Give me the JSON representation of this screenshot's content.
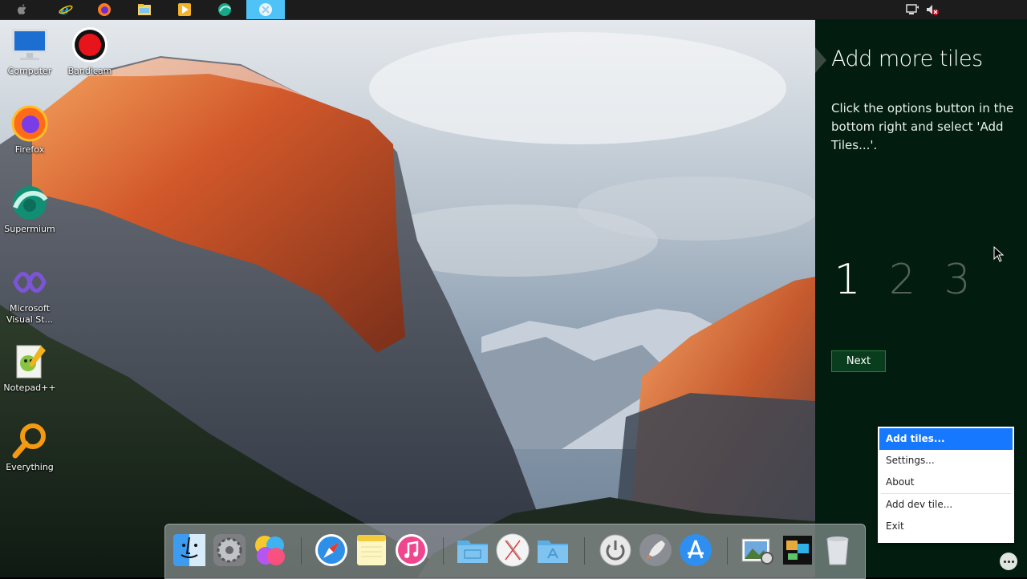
{
  "taskbar": {
    "buttons": [
      {
        "name": "apple-menu-icon"
      },
      {
        "name": "internet-explorer-icon"
      },
      {
        "name": "firefox-icon"
      },
      {
        "name": "file-explorer-icon"
      },
      {
        "name": "media-player-icon"
      },
      {
        "name": "supermium-icon"
      },
      {
        "name": "xwidget-icon",
        "active": true
      }
    ],
    "tray": [
      "network-icon",
      "volume-muted-icon"
    ]
  },
  "desktop": {
    "icons": [
      {
        "label": "Computer"
      },
      {
        "label": "Bandicam"
      },
      {
        "label": "Firefox"
      },
      {
        "label": "Supermium"
      },
      {
        "label": "Microsoft Visual St..."
      },
      {
        "label": "Notepad++"
      },
      {
        "label": "Everything"
      }
    ]
  },
  "panel": {
    "title": "Add more tiles",
    "body": "Click the options button in the bottom right and select 'Add Tiles...'.",
    "steps": [
      "1",
      "2",
      "3"
    ],
    "next_label": "Next"
  },
  "context_menu": {
    "items": [
      "Add tiles...",
      "Settings...",
      "About",
      "Add dev tile...",
      "Exit"
    ]
  },
  "dock": {
    "items": [
      "finder-icon",
      "system-preferences-icon",
      "game-center-icon",
      "safari-icon",
      "notes-icon",
      "itunes-icon",
      "folder-icon",
      "x-app-icon",
      "applications-folder-icon",
      "power-icon",
      "launchpad-rocket-icon",
      "app-store-icon",
      "preview-icon",
      "photo-slideshow-icon",
      "trash-icon"
    ]
  },
  "colors": {
    "panel_bg": "#021d10",
    "menu_highlight": "#1677ff",
    "taskbar_active": "#4fc3f7",
    "next_button": "#0a3d1e"
  }
}
